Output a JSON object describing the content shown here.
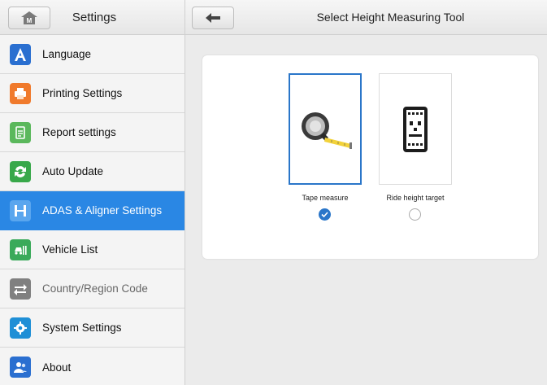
{
  "header": {
    "left_title": "Settings",
    "right_title": "Select Height Measuring Tool",
    "home_icon_letter": "M"
  },
  "sidebar": {
    "items": [
      {
        "label": "Language",
        "icon": "language-icon",
        "color": "#2a6fd0",
        "active": false
      },
      {
        "label": "Printing Settings",
        "icon": "printer-icon",
        "color": "#f07a2c",
        "active": false
      },
      {
        "label": "Report settings",
        "icon": "report-icon",
        "color": "#5bb85c",
        "active": false
      },
      {
        "label": "Auto Update",
        "icon": "update-icon",
        "color": "#38a84a",
        "active": false
      },
      {
        "label": "ADAS & Aligner Settings",
        "icon": "adas-icon",
        "color": "#2a87e4",
        "active": true
      },
      {
        "label": "Vehicle List",
        "icon": "vehicle-list-icon",
        "color": "#3aaa5a",
        "active": false
      },
      {
        "label": "Country/Region Code",
        "icon": "region-code-icon",
        "color": "#808080",
        "active": false
      },
      {
        "label": "System Settings",
        "icon": "system-settings-icon",
        "color": "#1f8fd6",
        "active": false
      },
      {
        "label": "About",
        "icon": "about-icon",
        "color": "#2a6fd0",
        "active": false
      }
    ]
  },
  "tools": [
    {
      "label": "Tape measure",
      "icon": "tape-measure-icon",
      "selected": true
    },
    {
      "label": "Ride height target",
      "icon": "ride-height-target-icon",
      "selected": false
    }
  ],
  "colors": {
    "accent": "#2a87e4",
    "selected_border": "#2a76c9"
  }
}
